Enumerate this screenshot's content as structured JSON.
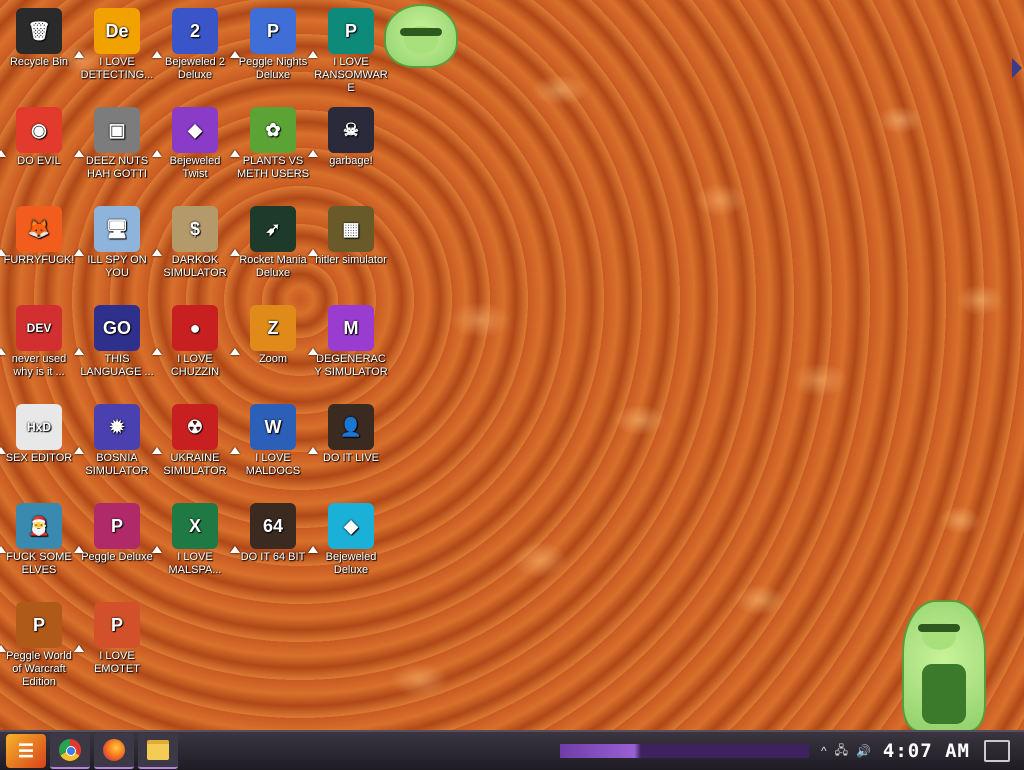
{
  "desktop": {
    "icons": [
      {
        "label": "Recycle Bin",
        "icon": "recycle-bin-icon",
        "color": "#2a2a2a",
        "glyph": "🗑"
      },
      {
        "label": "I LOVE DETECTING...",
        "icon": "detect-it-easy-icon",
        "color": "#f2a200",
        "glyph": "De"
      },
      {
        "label": "Bejeweled 2 Deluxe",
        "icon": "bejeweled-2-icon",
        "color": "#3a55c8",
        "glyph": "2"
      },
      {
        "label": "Peggle Nights Deluxe",
        "icon": "peggle-nights-icon",
        "color": "#3f6fd6",
        "glyph": "P"
      },
      {
        "label": "I LOVE RANSOMWARE",
        "icon": "publisher-icon",
        "color": "#0e8a7a",
        "glyph": "P"
      },
      {
        "label": "DO EVIL",
        "icon": "chrome-icon",
        "color": "#e23b2e",
        "glyph": "◉"
      },
      {
        "label": "DEEZ NUTS HAH GOTTI",
        "icon": "window-stack-icon",
        "color": "#7c7c7c",
        "glyph": "▣"
      },
      {
        "label": "Bejeweled Twist",
        "icon": "bejeweled-twist-icon",
        "color": "#8a3cc8",
        "glyph": "◆"
      },
      {
        "label": "PLANTS VS METH USERS",
        "icon": "plants-vs-zombies-icon",
        "color": "#5aa334",
        "glyph": "✿"
      },
      {
        "label": "garbage!",
        "icon": "steam-skull-icon",
        "color": "#2a2a3a",
        "glyph": "☠"
      },
      {
        "label": "FURRYFUCK!",
        "icon": "firefox-icon",
        "color": "#f25c1c",
        "glyph": "🦊"
      },
      {
        "label": "ILL SPY ON YOU",
        "icon": "remote-desktop-icon",
        "color": "#8fb4dc",
        "glyph": "🖥"
      },
      {
        "label": "DARKOK SIMULATOR",
        "icon": "money-bag-icon",
        "color": "#b49a6a",
        "glyph": "$"
      },
      {
        "label": "Rocket Mania Deluxe",
        "icon": "rocket-mania-icon",
        "color": "#1d3a2a",
        "glyph": "➶"
      },
      {
        "label": "hitler simulator",
        "icon": "medal-icon",
        "color": "#6a5a2a",
        "glyph": "▦"
      },
      {
        "label": "never used why is it ...",
        "icon": "dev-cpp-icon",
        "color": "#d23030",
        "glyph": "DEV"
      },
      {
        "label": "THIS LANGUAGE ...",
        "icon": "goland-icon",
        "color": "#2f2f8c",
        "glyph": "GO"
      },
      {
        "label": "I LOVE CHUZZIN",
        "icon": "chuzzle-icon",
        "color": "#c82020",
        "glyph": "●"
      },
      {
        "label": "Zoom",
        "icon": "zuma-icon",
        "color": "#e08a1a",
        "glyph": "Z"
      },
      {
        "label": "DEGENERACY SIMULATOR",
        "icon": "visual-studio-icon",
        "color": "#9a3cd0",
        "glyph": "M"
      },
      {
        "label": "SEX EDITOR",
        "icon": "hxd-icon",
        "color": "#e8e8e8",
        "glyph": "HxD"
      },
      {
        "label": "BOSNIA SIMULATOR",
        "icon": "spiked-mine-icon",
        "color": "#4a40b0",
        "glyph": "✹"
      },
      {
        "label": "UKRAINE SIMULATOR",
        "icon": "radiation-icon",
        "color": "#c82020",
        "glyph": "☢"
      },
      {
        "label": "I LOVE MALDOCS",
        "icon": "word-icon",
        "color": "#2b5fb8",
        "glyph": "W"
      },
      {
        "label": "DO IT LIVE",
        "icon": "portrait-icon",
        "color": "#3a2a20",
        "glyph": "👤"
      },
      {
        "label": "FUCK SOME ELVES",
        "icon": "santa-icon",
        "color": "#3a8ab0",
        "glyph": "🎅"
      },
      {
        "label": "Peggle Deluxe",
        "icon": "peggle-icon",
        "color": "#b02a6a",
        "glyph": "P"
      },
      {
        "label": "I LOVE MALSPA...",
        "icon": "excel-icon",
        "color": "#1e7a42",
        "glyph": "X"
      },
      {
        "label": "DO IT 64 BIT",
        "icon": "portrait-64-icon",
        "color": "#3a2a20",
        "glyph": "64"
      },
      {
        "label": "Bejeweled Deluxe",
        "icon": "diamond-icon",
        "color": "#1ab0d8",
        "glyph": "◆"
      },
      {
        "label": "Peggle World of Warcraft Edition",
        "icon": "peggle-wow-icon",
        "color": "#b05a1a",
        "glyph": "P"
      },
      {
        "label": "I LOVE EMOTET",
        "icon": "powerpoint-icon",
        "color": "#d2502a",
        "glyph": "P"
      }
    ]
  },
  "taskbar": {
    "clock": "4:07 AM",
    "items": [
      {
        "name": "chrome"
      },
      {
        "name": "firefox"
      },
      {
        "name": "file-explorer"
      }
    ],
    "tray": {
      "chevron": "^",
      "network": "🖧",
      "volume": "🔊"
    }
  }
}
